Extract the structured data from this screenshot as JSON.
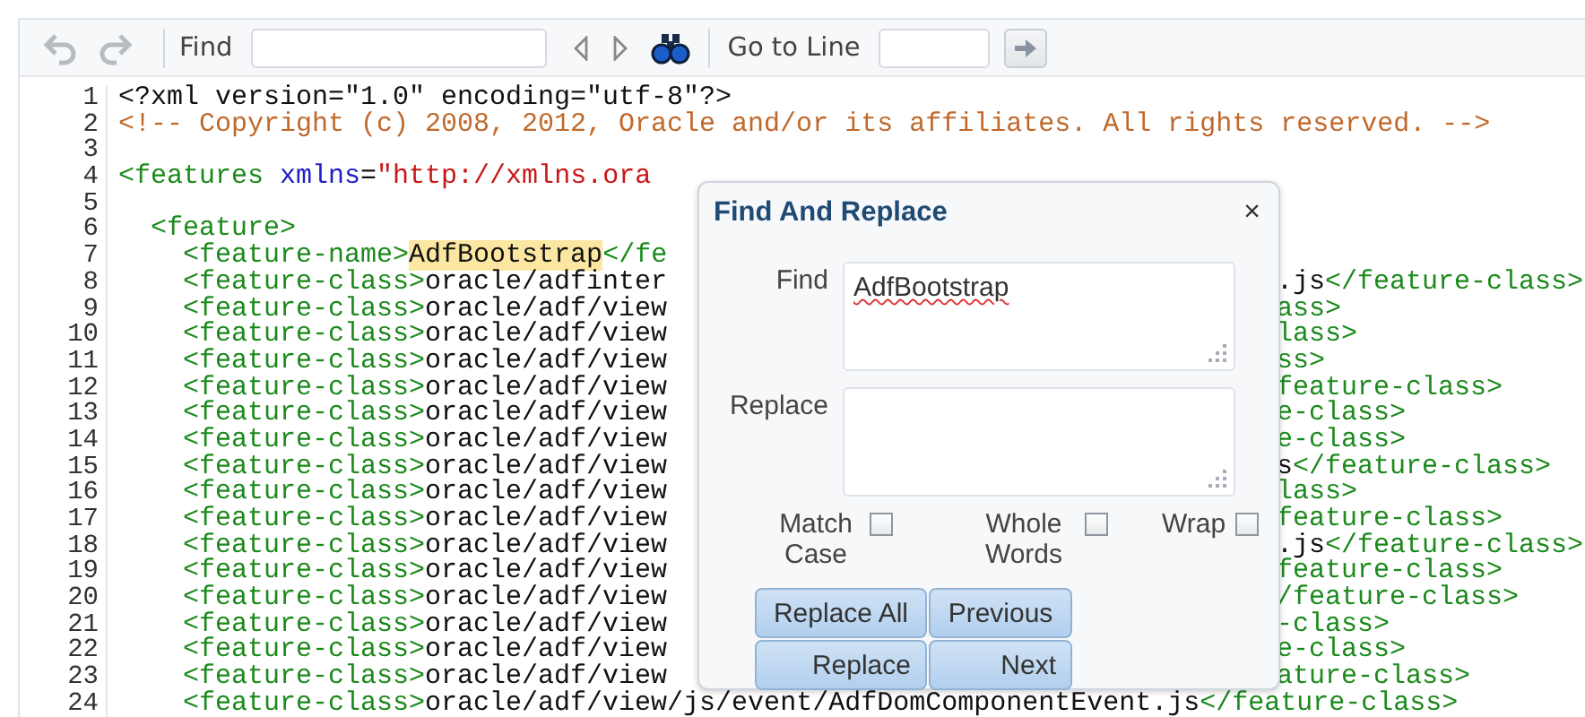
{
  "toolbar": {
    "find_label": "Find",
    "goto_label": "Go to Line"
  },
  "editor": {
    "lines": [
      {
        "number": "1",
        "left": [
          {
            "kind": "plain",
            "text": "<?xml version=\"1.0\" encoding=\"utf-8\"?>"
          }
        ]
      },
      {
        "number": "2",
        "left": [
          {
            "kind": "comment",
            "text": "<!-- Copyright (c) 2008, 2012, Oracle and/or its affiliates. All rights reserved. -->"
          }
        ]
      },
      {
        "number": "3"
      },
      {
        "number": "4",
        "left": [
          {
            "kind": "tag",
            "text": "<features "
          },
          {
            "kind": "attr",
            "text": "xmlns"
          },
          {
            "kind": "plain",
            "text": "="
          },
          {
            "kind": "value",
            "text": "\"http://xmlns.ora"
          }
        ]
      },
      {
        "number": "5"
      },
      {
        "number": "6",
        "left": [
          {
            "kind": "tag",
            "text": "  <feature>"
          }
        ]
      },
      {
        "number": "7",
        "left": [
          {
            "kind": "tag",
            "text": "    <feature-name>"
          },
          {
            "kind": "match",
            "text": "AdfBootstrap"
          },
          {
            "kind": "tag",
            "text": "</fe"
          }
        ]
      },
      {
        "number": "8",
        "left": [
          {
            "kind": "tag",
            "text": "    <feature-class>"
          },
          {
            "kind": "plain",
            "text": "oracle/adfinter"
          }
        ],
        "right": [
          {
            "kind": "plain",
            "text": ".js"
          },
          {
            "kind": "tag",
            "text": "</feature-class>"
          }
        ]
      },
      {
        "number": "9",
        "left": [
          {
            "kind": "tag",
            "text": "    <feature-class>"
          },
          {
            "kind": "plain",
            "text": "oracle/adf/view"
          }
        ],
        "right": [
          {
            "kind": "tag",
            "text": "ass>"
          }
        ]
      },
      {
        "number": "10",
        "left": [
          {
            "kind": "tag",
            "text": "    <feature-class>"
          },
          {
            "kind": "plain",
            "text": "oracle/adf/view"
          }
        ],
        "right": [
          {
            "kind": "tag",
            "text": "lass>"
          }
        ]
      },
      {
        "number": "11",
        "left": [
          {
            "kind": "tag",
            "text": "    <feature-class>"
          },
          {
            "kind": "plain",
            "text": "oracle/adf/view"
          }
        ],
        "right": [
          {
            "kind": "tag",
            "text": "ss>"
          }
        ]
      },
      {
        "number": "12",
        "left": [
          {
            "kind": "tag",
            "text": "    <feature-class>"
          },
          {
            "kind": "plain",
            "text": "oracle/adf/view"
          }
        ],
        "right": [
          {
            "kind": "tag",
            "text": "feature-class>"
          }
        ]
      },
      {
        "number": "13",
        "left": [
          {
            "kind": "tag",
            "text": "    <feature-class>"
          },
          {
            "kind": "plain",
            "text": "oracle/adf/view"
          }
        ],
        "right": [
          {
            "kind": "tag",
            "text": "e-class>"
          }
        ]
      },
      {
        "number": "14",
        "left": [
          {
            "kind": "tag",
            "text": "    <feature-class>"
          },
          {
            "kind": "plain",
            "text": "oracle/adf/view"
          }
        ],
        "right": [
          {
            "kind": "tag",
            "text": "e-class>"
          }
        ]
      },
      {
        "number": "15",
        "left": [
          {
            "kind": "tag",
            "text": "    <feature-class>"
          },
          {
            "kind": "plain",
            "text": "oracle/adf/view"
          }
        ],
        "right": [
          {
            "kind": "plain",
            "text": "s"
          },
          {
            "kind": "tag",
            "text": "</feature-class>"
          }
        ]
      },
      {
        "number": "16",
        "left": [
          {
            "kind": "tag",
            "text": "    <feature-class>"
          },
          {
            "kind": "plain",
            "text": "oracle/adf/view"
          }
        ],
        "right": [
          {
            "kind": "tag",
            "text": "lass>"
          }
        ]
      },
      {
        "number": "17",
        "left": [
          {
            "kind": "tag",
            "text": "    <feature-class>"
          },
          {
            "kind": "plain",
            "text": "oracle/adf/view"
          }
        ],
        "right": [
          {
            "kind": "tag",
            "text": "feature-class>"
          }
        ]
      },
      {
        "number": "18",
        "left": [
          {
            "kind": "tag",
            "text": "    <feature-class>"
          },
          {
            "kind": "plain",
            "text": "oracle/adf/view"
          }
        ],
        "right": [
          {
            "kind": "plain",
            "text": ".js"
          },
          {
            "kind": "tag",
            "text": "</feature-class>"
          }
        ]
      },
      {
        "number": "19",
        "left": [
          {
            "kind": "tag",
            "text": "    <feature-class>"
          },
          {
            "kind": "plain",
            "text": "oracle/adf/view"
          }
        ],
        "right": [
          {
            "kind": "tag",
            "text": "feature-class>"
          }
        ]
      },
      {
        "number": "20",
        "left": [
          {
            "kind": "tag",
            "text": "    <feature-class>"
          },
          {
            "kind": "plain",
            "text": "oracle/adf/view"
          }
        ],
        "right": [
          {
            "kind": "tag",
            "text": "/feature-class>"
          }
        ]
      },
      {
        "number": "21",
        "left": [
          {
            "kind": "tag",
            "text": "    <feature-class>"
          },
          {
            "kind": "plain",
            "text": "oracle/adf/view"
          }
        ],
        "right": [
          {
            "kind": "tag",
            "text": "-class>"
          }
        ]
      },
      {
        "number": "22",
        "left": [
          {
            "kind": "tag",
            "text": "    <feature-class>"
          },
          {
            "kind": "plain",
            "text": "oracle/adf/view"
          }
        ],
        "right": [
          {
            "kind": "tag",
            "text": "e-class>"
          }
        ]
      },
      {
        "number": "23",
        "left": [
          {
            "kind": "tag",
            "text": "    <feature-class>"
          },
          {
            "kind": "plain",
            "text": "oracle/adf/view"
          }
        ],
        "right": [
          {
            "kind": "tag",
            "text": "ature-class>"
          }
        ]
      },
      {
        "number": "24",
        "left": [
          {
            "kind": "tag",
            "text": "    <feature-class>"
          },
          {
            "kind": "plain",
            "text": "oracle/adf/view/js/event/AdfDomComponentEvent.js"
          },
          {
            "kind": "tag",
            "text": "</feature-class>"
          }
        ]
      }
    ]
  },
  "dialog": {
    "title": "Find And Replace",
    "close": "×",
    "find_label": "Find",
    "find_value": "AdfBootstrap",
    "replace_label": "Replace",
    "options": [
      {
        "label": "Match Case",
        "checked": false
      },
      {
        "label": "Whole Words",
        "checked": false
      },
      {
        "label": "Wrap",
        "checked": false
      }
    ],
    "buttons": [
      "Replace All",
      "Previous",
      "Replace",
      "Next"
    ]
  }
}
